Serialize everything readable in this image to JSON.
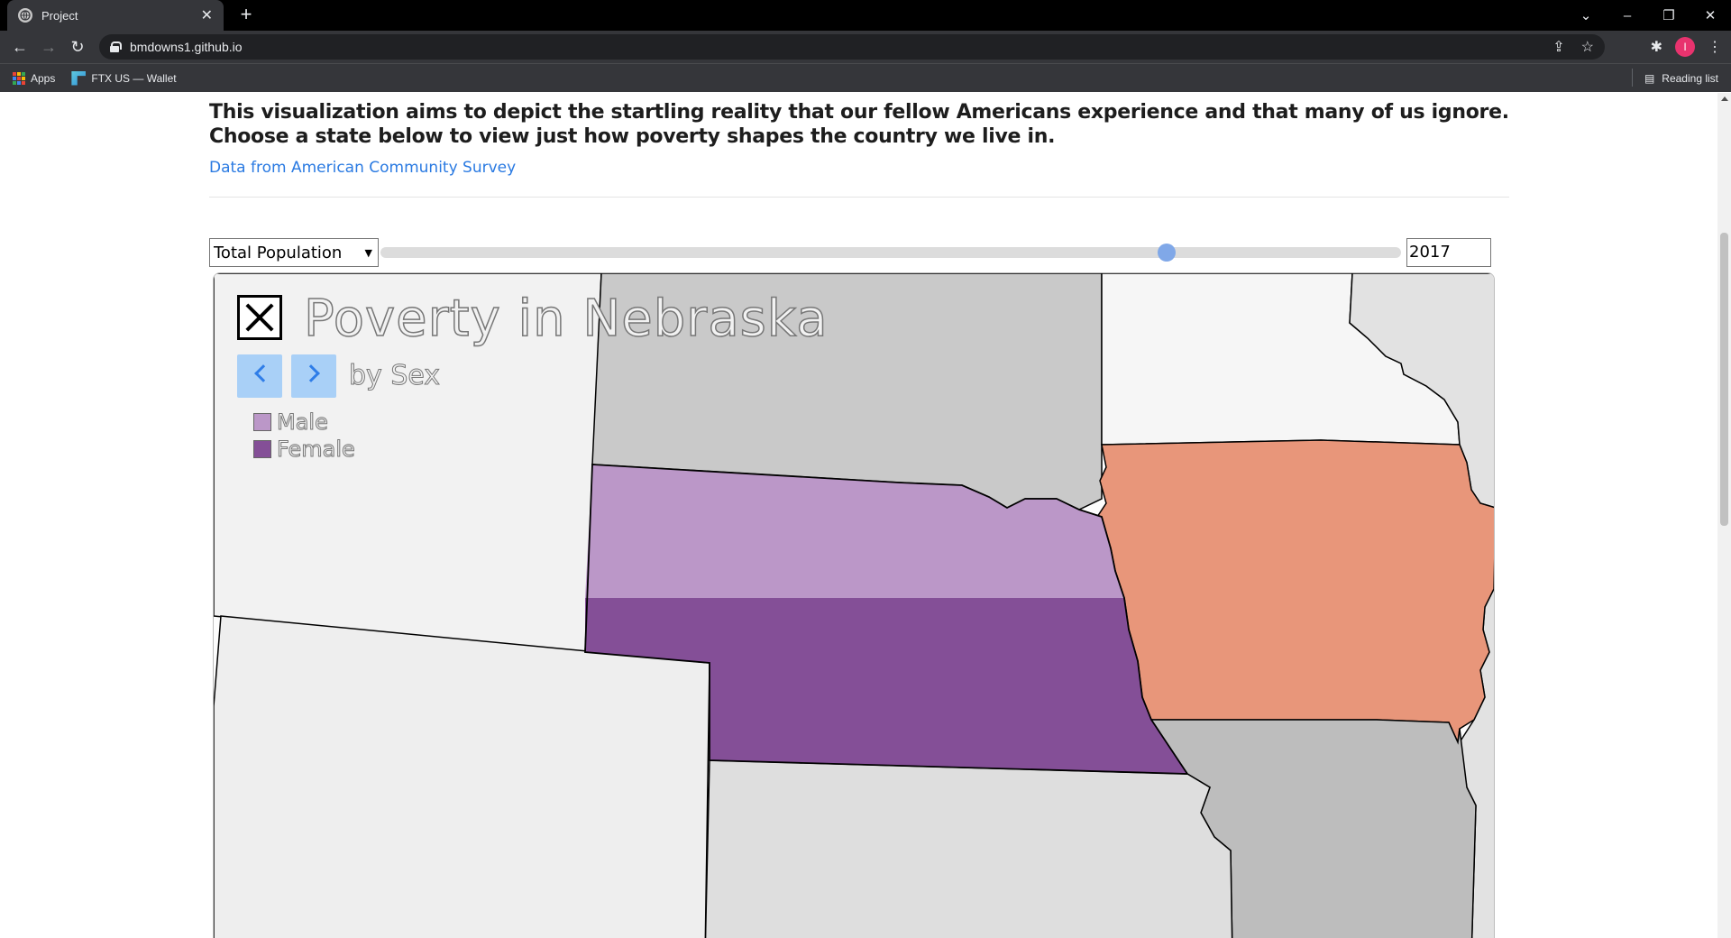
{
  "browser": {
    "tab_title": "Project",
    "url": "bmdowns1.github.io",
    "bookmarks": [
      {
        "label": "Apps"
      },
      {
        "label": "FTX US — Wallet"
      }
    ],
    "reading_list": "Reading list",
    "profile_initial": "I"
  },
  "page": {
    "intro_line1": "This visualization aims to depict the startling reality that our fellow Americans experience and that many of us ignore.",
    "intro_line2": "Choose a state below to view just how poverty shapes the country we live in.",
    "source_link": "Data from American Community Survey",
    "select_value": "Total Population",
    "year_value": "2017",
    "slider_position": 0.77
  },
  "map": {
    "title": "Poverty in Nebraska",
    "subtitle": "by Sex",
    "legend": [
      {
        "label": "Male",
        "color": "#bb97c8"
      },
      {
        "label": "Female",
        "color": "#844f97"
      }
    ],
    "colors": {
      "iowa": "#e8967a",
      "gray_dark": "#c9c9c9",
      "gray_mid": "#bdbdbd",
      "gray_light": "#dedede",
      "gray_lighter": "#eeeeee",
      "near_white": "#f6f6f6"
    }
  }
}
